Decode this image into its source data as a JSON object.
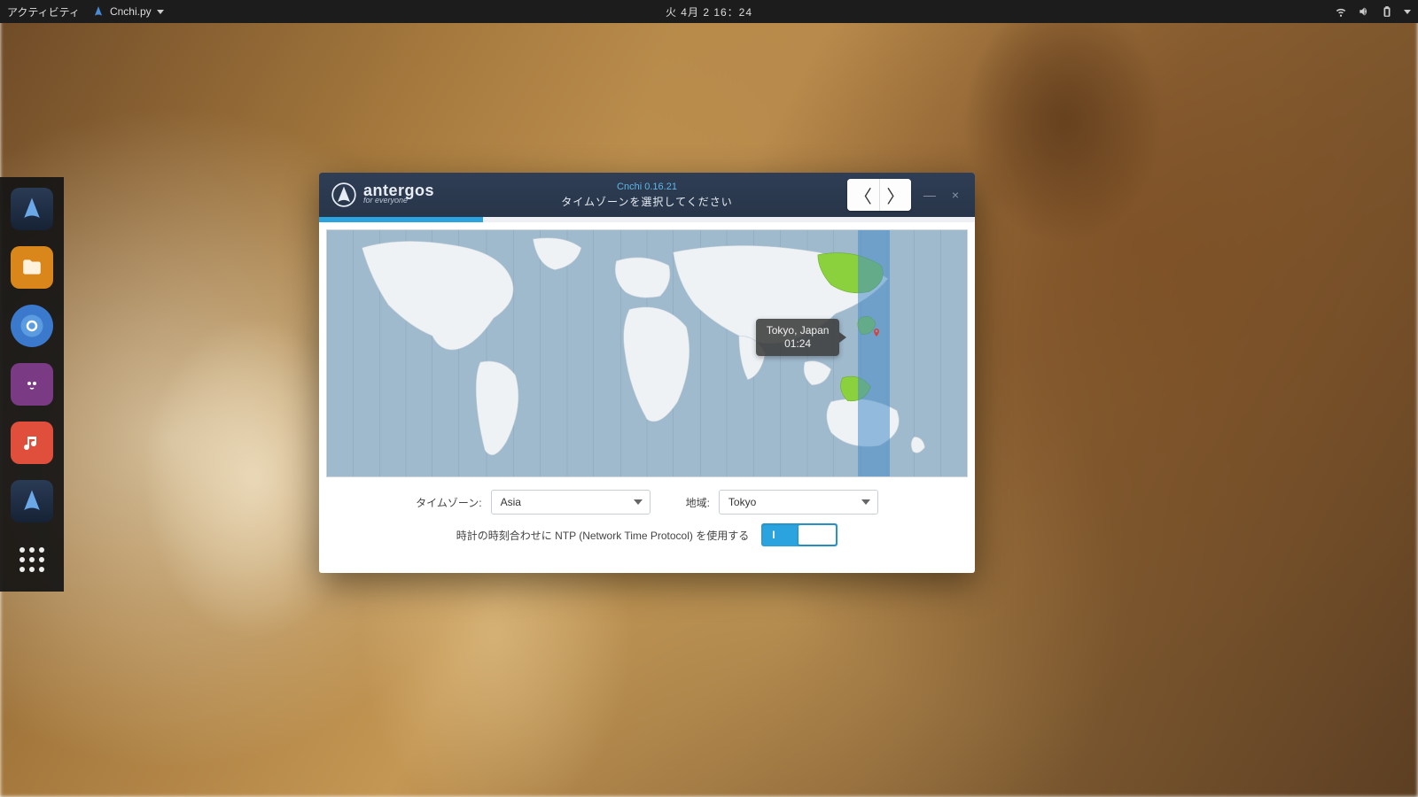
{
  "topbar": {
    "activities": "アクティビティ",
    "app_name": "Cnchi.py",
    "clock": "火 4月 2 16：24"
  },
  "dock": {
    "items": [
      "antergos-installer",
      "files",
      "chromium",
      "tweet-app",
      "music",
      "antergos-installer",
      "show-apps"
    ]
  },
  "window": {
    "brand_name": "antergos",
    "brand_tag": "for everyone",
    "version": "Cnchi  0.16.21",
    "subtitle": "タイムゾーンを選択してください",
    "progress_percent": 25,
    "nav": {
      "back": "〈",
      "forward": "〉"
    },
    "min": "—",
    "close": "×"
  },
  "map": {
    "tooltip_city": "Tokyo, Japan",
    "tooltip_time": "01:24"
  },
  "form": {
    "tz_label": "タイムゾーン:",
    "tz_value": "Asia",
    "region_label": "地域:",
    "region_value": "Tokyo",
    "ntp_label": "時計の時刻合わせに NTP (Network Time Protocol) を使用する",
    "switch_on": "I"
  }
}
